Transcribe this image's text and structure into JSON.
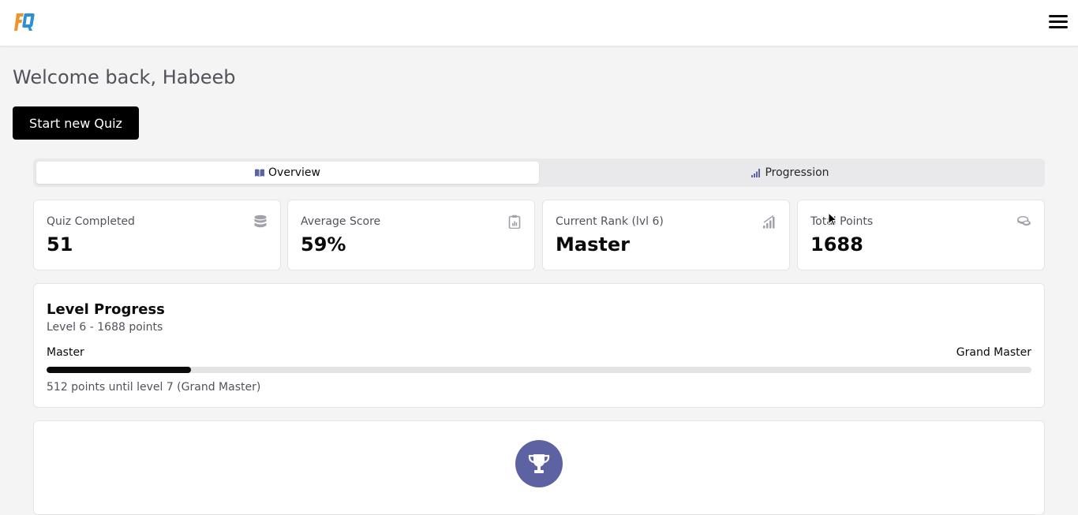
{
  "header": {
    "logo_text": "FQ",
    "menu_icon": "hamburger-menu-icon"
  },
  "welcome": {
    "text": "Welcome back, Habeeb"
  },
  "actions": {
    "start_quiz_label": "Start new Quiz"
  },
  "tabs": [
    {
      "label": "Overview",
      "icon": "book-open-icon",
      "active": true
    },
    {
      "label": "Progression",
      "icon": "bar-chart-icon",
      "active": false
    }
  ],
  "stats": [
    {
      "label": "Quiz Completed",
      "value": "51",
      "icon": "database-icon"
    },
    {
      "label": "Average Score",
      "value": "59%",
      "icon": "clipboard-icon"
    },
    {
      "label": "Current Rank (lvl 6)",
      "value": "Master",
      "icon": "signal-icon"
    },
    {
      "label": "Total Points",
      "value": "1688",
      "icon": "coins-icon"
    }
  ],
  "level_progress": {
    "title": "Level Progress",
    "subtitle": "Level 6 - 1688 points",
    "current_rank": "Master",
    "next_rank": "Grand Master",
    "progress_fraction": 0.147,
    "note": "512 points until level 7 (Grand Master)"
  },
  "colors": {
    "accent": "#5d62a3",
    "primary": "#000000",
    "background": "#f4f4f5",
    "logo_orange": "#f0932b",
    "logo_blue": "#2d8fd5"
  }
}
